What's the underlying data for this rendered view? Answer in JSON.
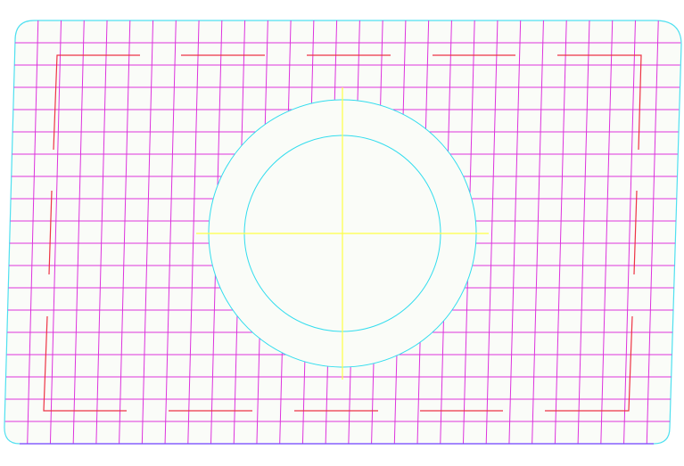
{
  "pattern": {
    "colors": {
      "background": "#ffffff",
      "panel_fill": "#fafcf8",
      "border": "#4fe0f0",
      "grid": "#dd33dd",
      "safe_marks": "#ee3344",
      "crosshair": "#ffff44",
      "circles": "#33ddee",
      "bottom_edge": "#8844ff"
    },
    "grid_columns": 29,
    "grid_rows": 19,
    "rings": 2
  }
}
